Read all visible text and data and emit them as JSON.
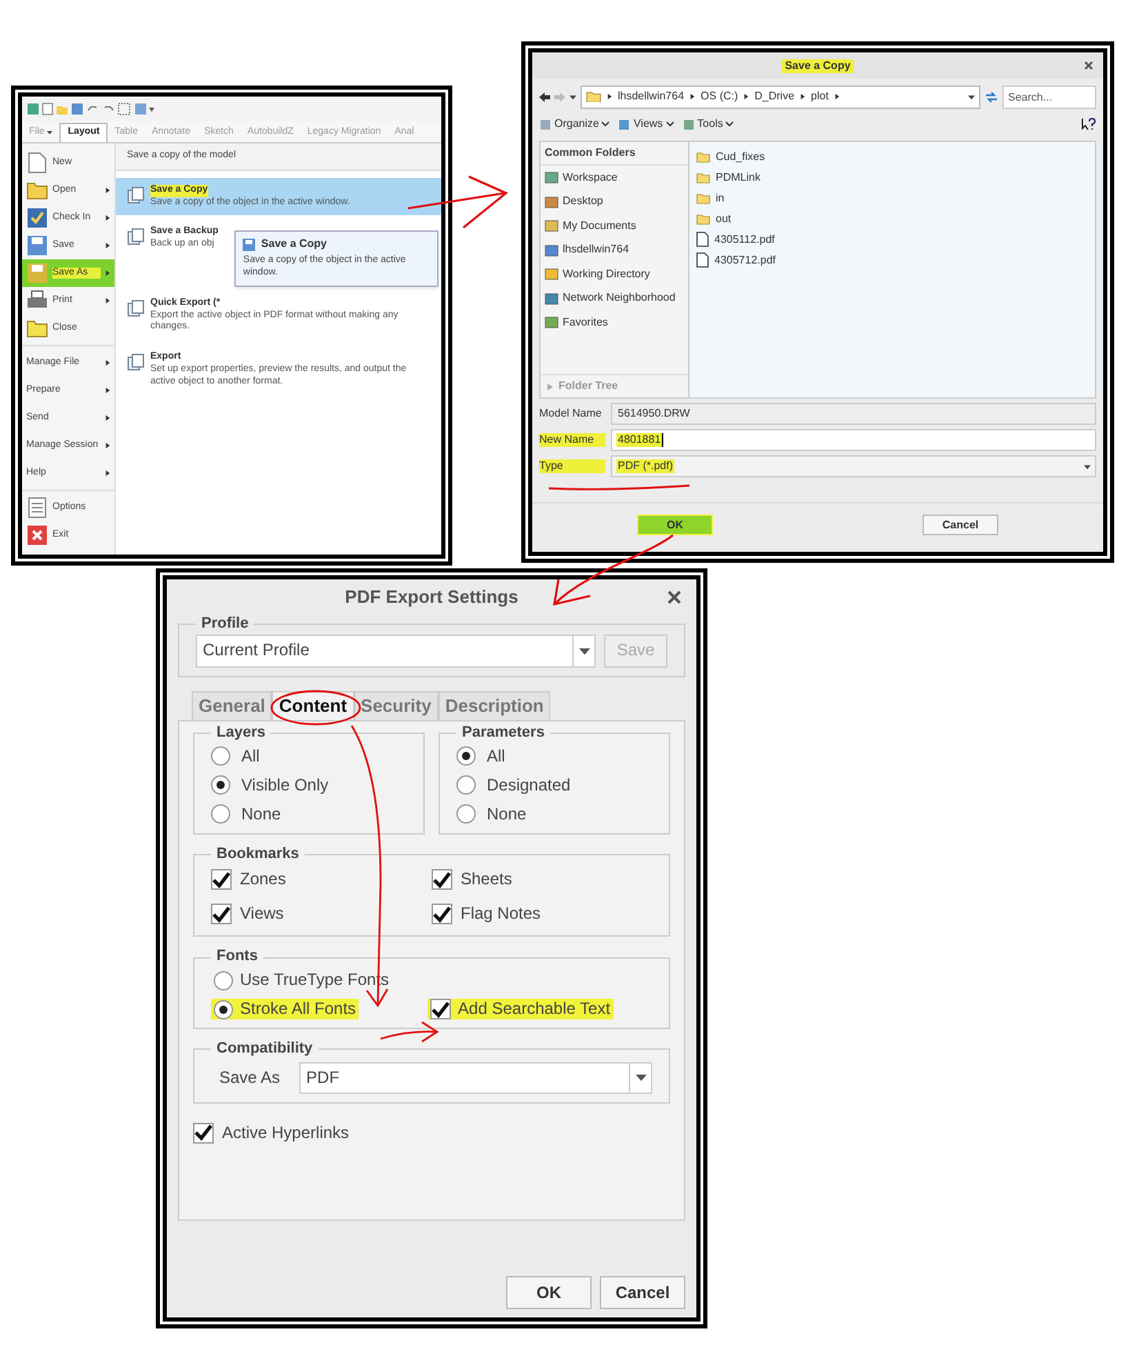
{
  "ribbon_window": {
    "tabs": [
      {
        "label": "File",
        "dropdown": true,
        "selected": false
      },
      {
        "label": "Layout",
        "dropdown": false,
        "selected": true
      },
      {
        "label": "Table",
        "dropdown": false,
        "selected": false
      },
      {
        "label": "Annotate",
        "dropdown": false,
        "selected": false
      },
      {
        "label": "Sketch",
        "dropdown": false,
        "selected": false
      },
      {
        "label": "AutobuildZ",
        "dropdown": false,
        "selected": false
      },
      {
        "label": "Legacy Migration",
        "dropdown": false,
        "selected": false
      },
      {
        "label": "Anal",
        "dropdown": false,
        "selected": false
      }
    ],
    "file_menu": [
      [
        {
          "label": "New",
          "submenu": false,
          "selected": false
        },
        {
          "label": "Open",
          "submenu": true,
          "selected": false
        },
        {
          "label": "Check In",
          "submenu": true,
          "selected": false
        },
        {
          "label": "Save",
          "submenu": true,
          "selected": false
        },
        {
          "label": "Save As",
          "submenu": true,
          "selected": true
        },
        {
          "label": "Print",
          "submenu": true,
          "selected": false
        },
        {
          "label": "Close",
          "submenu": false,
          "selected": false
        }
      ],
      [
        {
          "label": "Manage File",
          "submenu": true,
          "selected": false
        },
        {
          "label": "Prepare",
          "submenu": true,
          "selected": false
        },
        {
          "label": "Send",
          "submenu": true,
          "selected": false
        },
        {
          "label": "Manage Session",
          "submenu": true,
          "selected": false
        },
        {
          "label": "Help",
          "submenu": true,
          "selected": false
        }
      ],
      [
        {
          "label": "Options",
          "submenu": false,
          "selected": false
        },
        {
          "label": "Exit",
          "submenu": false,
          "selected": false
        }
      ]
    ],
    "submenu": {
      "heading": "Save a copy of the model",
      "options": [
        {
          "title": "Save a Copy",
          "description": "Save a copy of the object in the active window.",
          "selected": true,
          "highlighted": true
        },
        {
          "title": "Save a Backup",
          "description": "Back up an obj",
          "selected": false,
          "highlighted": false,
          "tooltip": {
            "title": "Save a Copy",
            "text": "Save a copy of the object in the active window."
          }
        },
        {
          "title": "Quick Export (*",
          "description": "Export the active object in PDF format without making any changes.",
          "selected": false,
          "highlighted": false
        },
        {
          "title": "Export",
          "description": "Set up export properties, preview the results, and output the active object to another format.",
          "selected": false,
          "highlighted": false
        }
      ]
    }
  },
  "save_dialog": {
    "title": "Save a Copy",
    "title_highlighted": true,
    "path": [
      "lhsdellwin764",
      "OS (C:)",
      "D_Drive",
      "plot"
    ],
    "search": {
      "placeholder": "Search..."
    },
    "toolbar": [
      "Organize",
      "Views",
      "Tools"
    ],
    "common_folders": {
      "heading": "Common Folders",
      "items": [
        "Workspace",
        "Desktop",
        "My Documents",
        "lhsdellwin764",
        "Working Directory",
        "Network Neighborhood",
        "Favorites"
      ]
    },
    "folder_tree": "Folder Tree",
    "files": [
      {
        "name": "Cud_fixes",
        "kind": "folder"
      },
      {
        "name": "PDMLink",
        "kind": "folder"
      },
      {
        "name": "in",
        "kind": "folder"
      },
      {
        "name": "out",
        "kind": "folder"
      },
      {
        "name": "4305112.pdf",
        "kind": "file"
      },
      {
        "name": "4305712.pdf",
        "kind": "file"
      }
    ],
    "fields": [
      {
        "label": "Model Name",
        "value": "5614950.DRW",
        "kind": "readonly",
        "highlighted": false
      },
      {
        "label": "New Name",
        "value": "4801881",
        "kind": "input",
        "highlighted": true
      },
      {
        "label": "Type",
        "value": "PDF (*.pdf)",
        "kind": "dropdown",
        "highlighted": true
      }
    ],
    "buttons": [
      {
        "label": "OK",
        "highlighted": true
      },
      {
        "label": "Cancel",
        "highlighted": false
      }
    ]
  },
  "pdf_dialog": {
    "title": "PDF Export Settings",
    "profile": {
      "legend": "Profile",
      "value": "Current Profile",
      "save_button": {
        "label": "Save",
        "disabled": true
      }
    },
    "tabs": [
      {
        "label": "General",
        "selected": false,
        "highlighted": false
      },
      {
        "label": "Content",
        "selected": true,
        "highlighted": true
      },
      {
        "label": "Security",
        "selected": false,
        "highlighted": false
      },
      {
        "label": "Description",
        "selected": false,
        "highlighted": false
      }
    ],
    "layers": {
      "legend": "Layers",
      "options": [
        {
          "label": "All",
          "selected": false
        },
        {
          "label": "Visible Only",
          "selected": true
        },
        {
          "label": "None",
          "selected": false
        }
      ]
    },
    "parameters": {
      "legend": "Parameters",
      "options": [
        {
          "label": "All",
          "selected": true
        },
        {
          "label": "Designated",
          "selected": false
        },
        {
          "label": "None",
          "selected": false
        }
      ]
    },
    "bookmarks": {
      "legend": "Bookmarks",
      "items": [
        {
          "label": "Zones",
          "checked": true
        },
        {
          "label": "Sheets",
          "checked": true
        },
        {
          "label": "Views",
          "checked": true
        },
        {
          "label": "Flag Notes",
          "checked": true
        }
      ]
    },
    "fonts": {
      "legend": "Fonts",
      "items": [
        {
          "kind": "radio",
          "label": "Use TrueType Fonts",
          "selected": false,
          "highlighted": false
        },
        {
          "kind": "radio",
          "label": "Stroke All Fonts",
          "selected": true,
          "highlighted": true
        },
        {
          "kind": "checkbox",
          "label": "Add Searchable Text",
          "checked": true,
          "highlighted": true
        }
      ]
    },
    "compatibility": {
      "legend": "Compatibility",
      "label": "Save As",
      "value": "PDF"
    },
    "active_hyperlinks": {
      "label": "Active Hyperlinks",
      "checked": true
    },
    "buttons": [
      "OK",
      "Cancel"
    ]
  }
}
